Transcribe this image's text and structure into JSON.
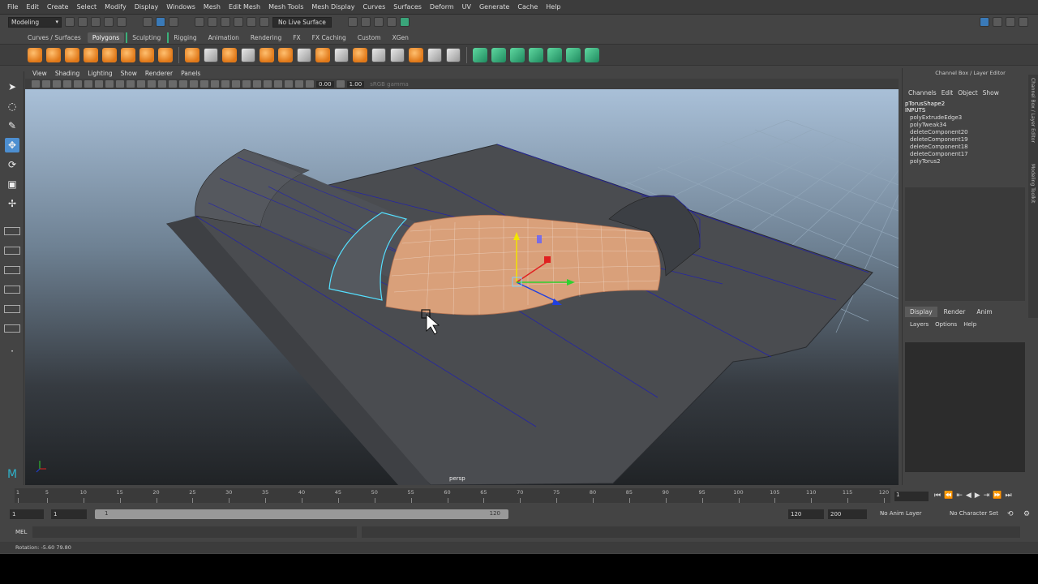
{
  "menubar": {
    "items": [
      "File",
      "Edit",
      "Create",
      "Select",
      "Modify",
      "Display",
      "Windows",
      "Mesh",
      "Edit Mesh",
      "Mesh Tools",
      "Mesh Display",
      "Curves",
      "Surfaces",
      "Deform",
      "UV",
      "Generate",
      "Cache",
      "Help"
    ]
  },
  "statusline": {
    "mode": "Modeling",
    "live_surface": "No Live Surface"
  },
  "shelf": {
    "tabs": [
      "Curves / Surfaces",
      "Polygons",
      "Sculpting",
      "Rigging",
      "Animation",
      "Rendering",
      "FX",
      "FX Caching",
      "Custom",
      "XGen"
    ],
    "active_tab": "Polygons"
  },
  "viewport": {
    "menu": [
      "View",
      "Shading",
      "Lighting",
      "Show",
      "Renderer",
      "Panels"
    ],
    "exposure": "0.00",
    "gamma": "1.00",
    "color_space": "sRGB gamma",
    "camera": "persp"
  },
  "channelbox": {
    "title": "Channel Box / Layer Editor",
    "menu": [
      "Channels",
      "Edit",
      "Object",
      "Show"
    ],
    "node": "pTorusShape2",
    "inputs_label": "INPUTS",
    "history": [
      "polyExtrudeEdge3",
      "polyTweak34",
      "deleteComponent20",
      "deleteComponent19",
      "deleteComponent18",
      "deleteComponent17",
      "polyTorus2"
    ],
    "side_tabs": [
      "Channel Box / Layer Editor",
      "Modeling Toolkit"
    ]
  },
  "layereditor": {
    "tabs": [
      "Display",
      "Render",
      "Anim"
    ],
    "active_tab": "Display",
    "menu": [
      "Layers",
      "Options",
      "Help"
    ]
  },
  "timeslider": {
    "labels": [
      "1",
      "5",
      "10",
      "15",
      "20",
      "25",
      "30",
      "35",
      "40",
      "45",
      "50",
      "55",
      "60",
      "65",
      "70",
      "75",
      "80",
      "85",
      "90",
      "95",
      "100",
      "105",
      "110",
      "115",
      "120"
    ],
    "current_frame": "1"
  },
  "rangeslider": {
    "start": "1",
    "range_start": "1",
    "range_label_start": "1",
    "range_label_end": "120",
    "range_end": "120",
    "end": "200",
    "anim_layer": "No Anim Layer",
    "character_set": "No Character Set"
  },
  "cmdline": {
    "label": "MEL"
  },
  "helpline": {
    "text": "Rotation:  -5.60        79.80"
  }
}
